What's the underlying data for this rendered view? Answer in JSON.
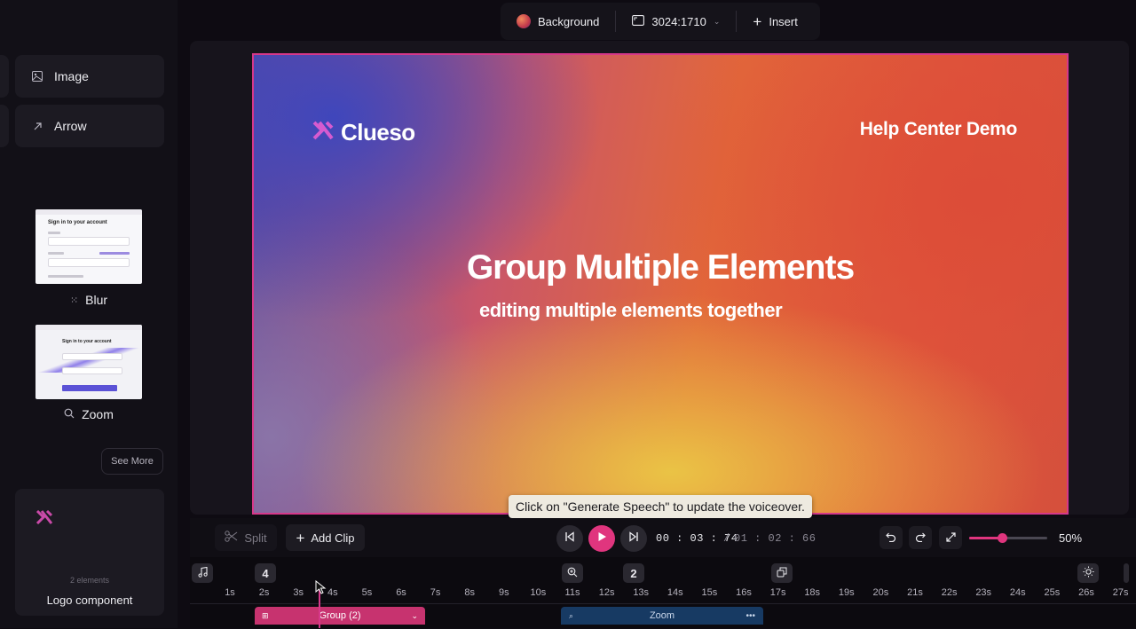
{
  "left_panel": {
    "tools": [
      {
        "label": "Image",
        "icon": "image-icon"
      },
      {
        "label": "Arrow",
        "icon": "arrow-up-right-icon"
      }
    ],
    "effects": [
      {
        "label": "Blur",
        "icon": "blur-icon",
        "thumb_title": "Sign in to your account"
      },
      {
        "label": "Zoom",
        "icon": "zoom-icon",
        "thumb_title": "Sign in to your account"
      }
    ],
    "see_more": "See More",
    "component": {
      "count": "2 elements",
      "label": "Logo component"
    }
  },
  "topbar": {
    "background_label": "Background",
    "aspect_label": "3024:1710",
    "insert_label": "Insert"
  },
  "canvas": {
    "brand": "Clueso",
    "help_title": "Help Center Demo",
    "main_title": "Group Multiple Elements",
    "sub_title": "editing multiple elements together",
    "border_color": "#d6388a"
  },
  "tooltip": "Click on \"Generate Speech\" to update the voiceover.",
  "controls": {
    "split_label": "Split",
    "add_clip_label": "Add Clip",
    "current_time": "00 : 03 : 74",
    "separator": "/",
    "total_time": "01 : 02 : 66",
    "zoom_percent": "50%",
    "zoom_level": 0.42,
    "accent": "#e0357e"
  },
  "timeline": {
    "markers": [
      {
        "kind": "music",
        "icon": "music-note-icon"
      },
      {
        "kind": "count",
        "label": "4"
      },
      {
        "kind": "zoom",
        "icon": "zoom-in-icon"
      },
      {
        "kind": "count",
        "label": "2"
      },
      {
        "kind": "layers",
        "icon": "layers-icon"
      },
      {
        "kind": "brightness",
        "icon": "sun-icon"
      }
    ],
    "ticks": [
      "1s",
      "2s",
      "3s",
      "4s",
      "5s",
      "6s",
      "7s",
      "8s",
      "9s",
      "10s",
      "11s",
      "12s",
      "13s",
      "14s",
      "15s",
      "16s",
      "17s",
      "18s",
      "19s",
      "20s",
      "21s",
      "22s",
      "23s",
      "24s",
      "25s",
      "26s",
      "27s"
    ],
    "clips": [
      {
        "label": "Group (2)",
        "color": "#c7336f"
      },
      {
        "label": "Zoom",
        "color": "#173a63"
      }
    ]
  }
}
